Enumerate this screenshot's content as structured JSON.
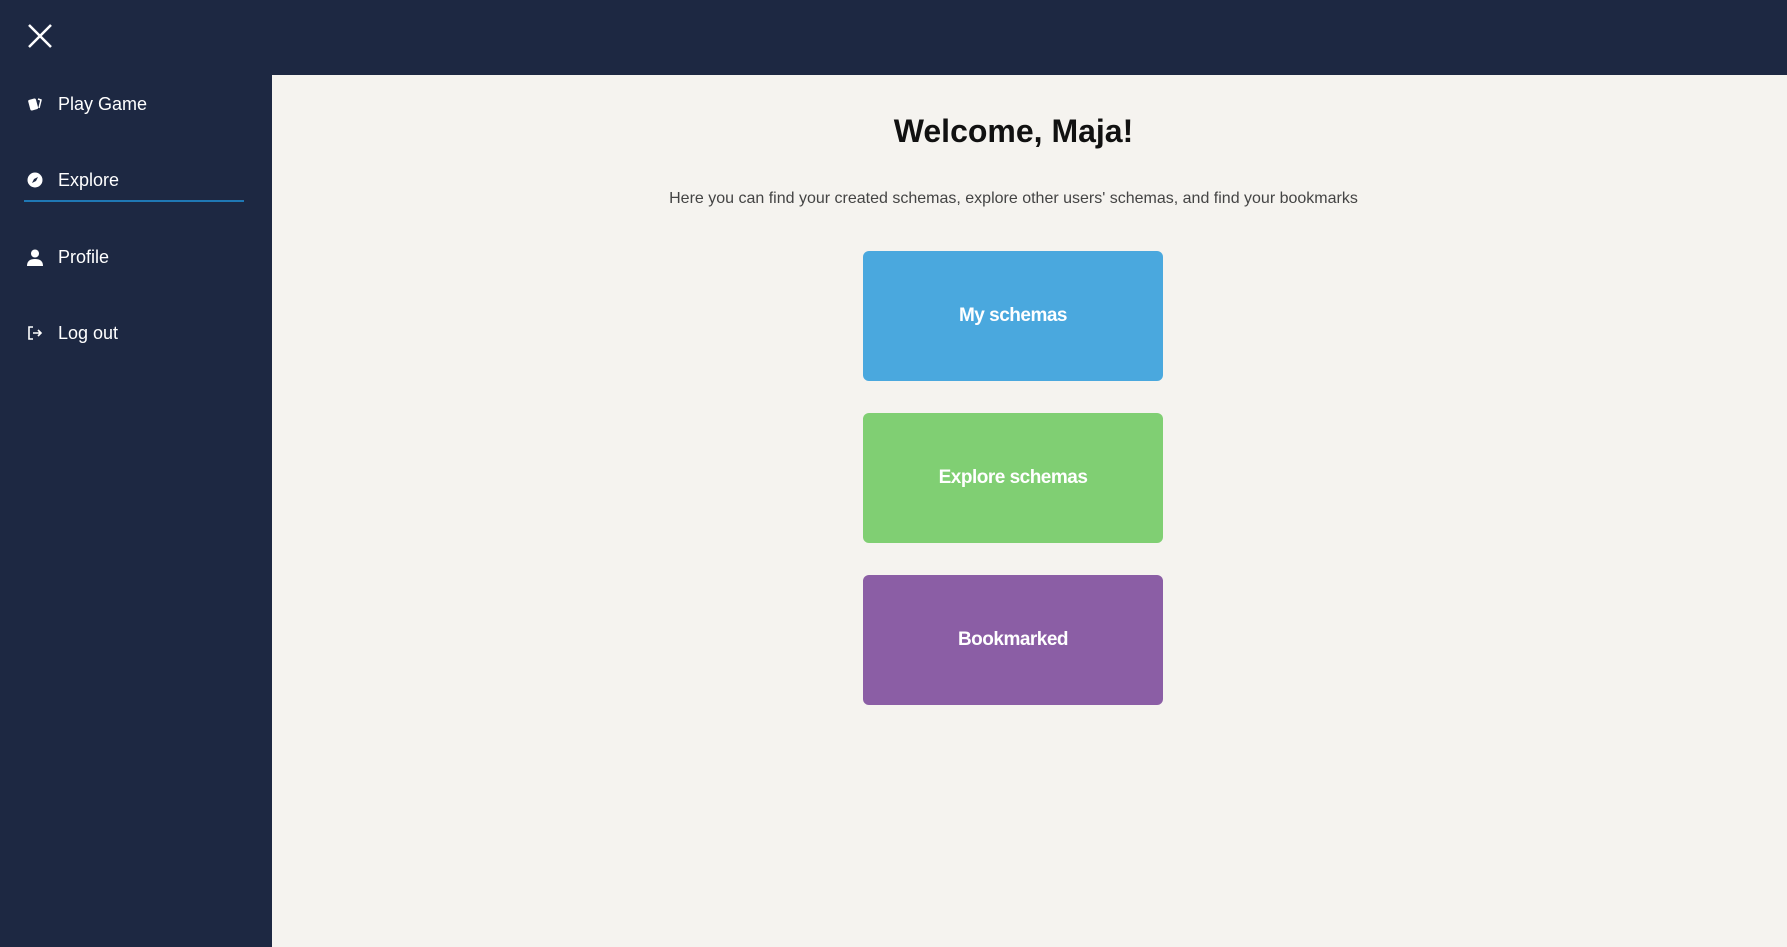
{
  "sidebar": {
    "items": [
      {
        "label": "Play Game",
        "icon": "cards-icon"
      },
      {
        "label": "Explore",
        "icon": "compass-icon",
        "active": true
      },
      {
        "label": "Profile",
        "icon": "user-icon"
      },
      {
        "label": "Log out",
        "icon": "logout-icon"
      }
    ]
  },
  "main": {
    "title": "Welcome, Maja!",
    "subtitle": "Here you can find your created schemas, explore other users' schemas, and find your bookmarks",
    "buttons": [
      {
        "label": "My schemas",
        "color": "#4aa8de"
      },
      {
        "label": "Explore schemas",
        "color": "#80cf73"
      },
      {
        "label": "Bookmarked",
        "color": "#8b5ea5"
      }
    ]
  }
}
